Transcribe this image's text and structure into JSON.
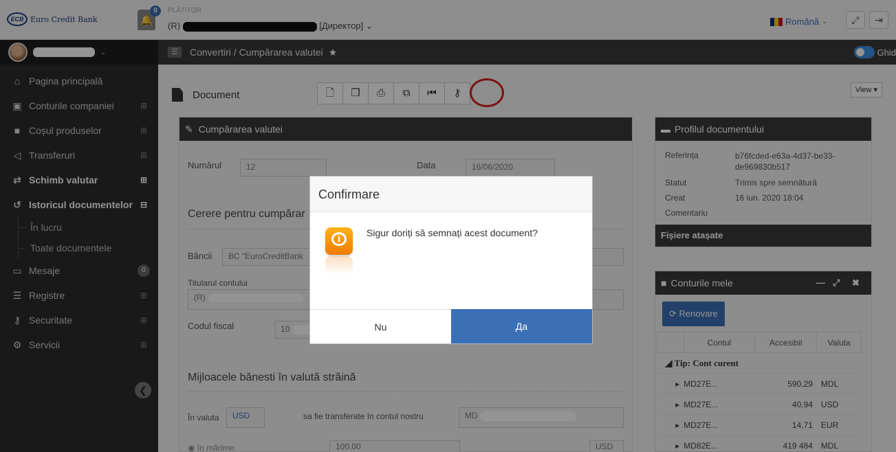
{
  "header": {
    "logo_mark": "ECB",
    "logo_text": "Euro Credit Bank",
    "notification_count": "0",
    "payer_label": "PLĂTITOR",
    "payer_prefix": "(R)",
    "payer_role": "[Директор] ⌄",
    "language": "Română",
    "flag_colors": [
      "#002b7f",
      "#fcd116",
      "#ce1126"
    ]
  },
  "sidebar": {
    "items": [
      {
        "label": "Pagina principală",
        "icon": "home-icon"
      },
      {
        "label": "Conturile companiei",
        "icon": "money-icon"
      },
      {
        "label": "Coșul produselor",
        "icon": "briefcase-icon"
      },
      {
        "label": "Transferuri",
        "icon": "send-icon"
      },
      {
        "label": "Schimb valutar",
        "icon": "exchange-icon"
      },
      {
        "label": "Istoricul documentelor",
        "icon": "history-icon"
      }
    ],
    "sub_items": [
      {
        "label": "În lucru"
      },
      {
        "label": "Toate documentele"
      }
    ],
    "items_after": [
      {
        "label": "Mesaje",
        "icon": "message-icon",
        "badge": "0"
      },
      {
        "label": "Registre",
        "icon": "list-icon"
      },
      {
        "label": "Securitate",
        "icon": "key-icon"
      },
      {
        "label": "Servicii",
        "icon": "cogs-icon"
      }
    ]
  },
  "breadcrumb": {
    "text": "Convertiri / Cumpărarea valutei",
    "guide_label": "Ghid"
  },
  "document": {
    "title": "Document",
    "view_label": "View ▾",
    "panel_title": "Cumpărarea valutei",
    "number_label": "Numărul",
    "number_value": "12",
    "date_label": "Data",
    "date_value": "16/06/2020",
    "section_request": "Cerere pentru cumpărar",
    "bank_label": "Băncii",
    "bank_value": "BC \"EuroCreditBank",
    "holder_label": "Titularul contului",
    "holder_value": "(R)",
    "fiscal_label": "Codul fiscal",
    "fiscal_value": "10",
    "section_funds": "Mijloacele bănesti în valută străină",
    "currency_label": "În valuta",
    "currency_value": "USD",
    "transfer_label": "sa fie transferate în contul nostru",
    "account_value": "MD",
    "amount_label": "în mărime:",
    "amount_value": "100.00",
    "amount_currency": "USD"
  },
  "profile": {
    "title": "Profilul documentului",
    "reference_label": "Referința",
    "reference_value": "b76fcded-e63a-4d37-be33-de969830b517",
    "status_label": "Statut",
    "status_value": "Trimis spre semnătură",
    "created_label": "Creat",
    "created_value": "16 iun. 2020 18:04",
    "comment_label": "Comentariu",
    "attachments_label": "Fișiere atașate"
  },
  "accounts": {
    "title": "Conturile mele",
    "renew_label": "Renovare",
    "columns": [
      "Contul",
      "Accesibil",
      "Valuta"
    ],
    "group_label": "Tip: Cont curent",
    "rows": [
      {
        "account": "MD27E...",
        "available": "590,29",
        "currency": "MDL"
      },
      {
        "account": "MD27E...",
        "available": "40,94",
        "currency": "USD"
      },
      {
        "account": "MD27E...",
        "available": "14,71",
        "currency": "EUR"
      },
      {
        "account": "MD82E...",
        "available": "419 484",
        "currency": "MDL"
      }
    ]
  },
  "modal": {
    "title": "Confirmare",
    "message": "Sigur doriți să semnați acest document?",
    "no_label": "Nu",
    "yes_label": "Да",
    "info_glyph": "i"
  }
}
